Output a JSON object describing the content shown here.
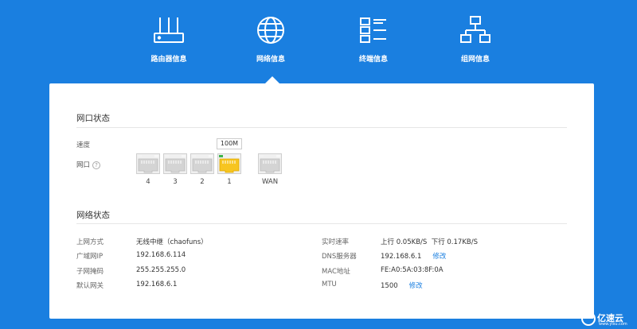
{
  "nav": {
    "items": [
      {
        "label": "路由器信息",
        "icon": "router-icon"
      },
      {
        "label": "网络信息",
        "icon": "globe-icon"
      },
      {
        "label": "终端信息",
        "icon": "device-list-icon"
      },
      {
        "label": "组网信息",
        "icon": "network-topology-icon"
      }
    ],
    "active_index": 1
  },
  "port_section": {
    "title": "网口状态",
    "speed_label": "速度",
    "speed_value": "100M",
    "port_label": "网口",
    "help_icon": "?",
    "ports": [
      {
        "name": "4",
        "active": false
      },
      {
        "name": "3",
        "active": false
      },
      {
        "name": "2",
        "active": false
      },
      {
        "name": "1",
        "active": true
      },
      {
        "name": "WAN",
        "active": false
      }
    ],
    "colors": {
      "active": "#f7c520",
      "inactive": "#d4d4d4",
      "led_on": "#3cb44b"
    }
  },
  "network_section": {
    "title": "网络状态",
    "left": [
      {
        "label": "上网方式",
        "value": "无线中继（chaofuns）"
      },
      {
        "label": "广域网IP",
        "value": "192.168.6.114"
      },
      {
        "label": "子网掩码",
        "value": "255.255.255.0"
      },
      {
        "label": "默认网关",
        "value": "192.168.6.1"
      }
    ],
    "right": [
      {
        "label": "实时速率",
        "value": "上行 0.05KB/S  下行 0.17KB/S",
        "link": ""
      },
      {
        "label": "DNS服务器",
        "value": "192.168.6.1",
        "link": "修改"
      },
      {
        "label": "MAC地址",
        "value": "FE:A0:5A:03:8F:0A",
        "link": ""
      },
      {
        "label": "MTU",
        "value": "1500",
        "link": "修改"
      }
    ]
  },
  "watermark": {
    "text": "亿速云",
    "sub": "www.yisu.com"
  },
  "colors": {
    "background": "#1a7fe0",
    "card": "#ffffff",
    "accent": "#1a7fe0"
  }
}
